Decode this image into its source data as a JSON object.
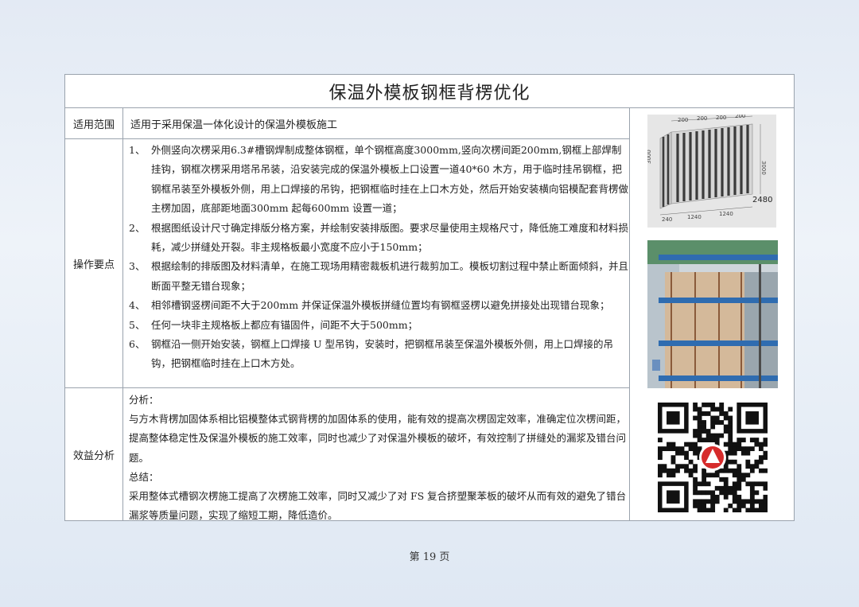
{
  "title": "保温外模板钢框背楞优化",
  "labels": {
    "scope": "适用范围",
    "operations": "操作要点",
    "benefit": "效益分析"
  },
  "scope_text": "适用于采用保温一体化设计的保温外模板施工",
  "operations": [
    {
      "num": "1、",
      "text": "外侧竖向次楞采用6.3#槽钢焊制成整体钢框，单个钢框高度3000mm,竖向次楞间距200mm,钢框上部焊制挂钩，钢框次楞采用塔吊吊装，沿安装完成的保温外模板上口设置一道40*60 木方，用于临时挂吊钢框，把钢框吊装至外模板外侧，用上口焊接的吊钩，把钢框临时挂在上口木方处，然后开始安装横向铝模配套背楞做主楞加固，底部距地面300mm 起每600mm 设置一道；"
    },
    {
      "num": "2、",
      "text": "根据图纸设计尺寸确定排版分格方案，并绘制安装排版图。要求尽量使用主规格尺寸，降低施工难度和材料损耗，减少拼缝处开裂。非主规格板最小宽度不应小于150mm；"
    },
    {
      "num": "3、",
      "text": "根据绘制的排版图及材料清单，在施工现场用精密裁板机进行裁剪加工。模板切割过程中禁止断面倾斜，并且断面平整无错台现象；"
    },
    {
      "num": "4、",
      "text": "相邻槽钢竖楞间距不大于200mm 并保证保温外模板拼缝位置均有钢框竖楞以避免拼接处出现错台现象；"
    },
    {
      "num": "5、",
      "text": "任何一块非主规格板上都应有锚固件，间距不大于500mm；"
    },
    {
      "num": "6、",
      "text": "钢框沿一侧开始安装，钢框上口焊接 U 型吊钩，安装时，把钢框吊装至保温外模板外侧，用上口焊接的吊钩，把钢框临时挂在上口木方处。"
    }
  ],
  "benefit": {
    "analysis_label": "分析：",
    "analysis_text": "与方木背楞加固体系相比铝模整体式钢背楞的加固体系的使用，能有效的提高次楞固定效率，准确定位次楞间距，提高整体稳定性及保温外模板的施工效率，同时也减少了对保温外模板的破坏，有效控制了拼缝处的漏浆及错台问题。",
    "summary_label": "总结：",
    "summary_text": "采用整体式槽钢次楞施工提高了次楞施工效率，同时又减少了对 FS 复合挤塑聚苯板的破坏从而有效的避免了错台漏浆等质量问题，实现了缩短工期，降低造价。"
  },
  "drawing": {
    "dims_top": [
      "200",
      "200",
      "200",
      "200"
    ],
    "dim_height": "3000",
    "dims_bottom": [
      "240",
      "1240",
      "1240"
    ],
    "dim_total": "2480"
  },
  "footer": "第 19 页"
}
